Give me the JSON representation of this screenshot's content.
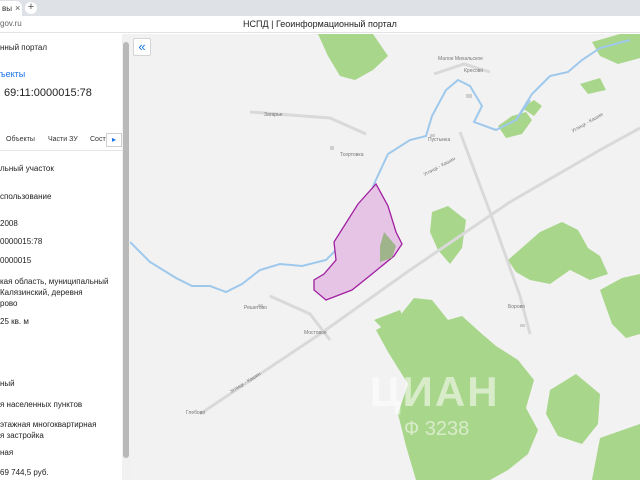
{
  "browser": {
    "tab_title": "вы",
    "tab_close": "×",
    "new_tab": "+",
    "address": "gov.ru",
    "page_title": "НСПД | Геоинформационный портал"
  },
  "panel": {
    "portal_label": "нный портал",
    "objects_link": "ъекты",
    "cadastral_number": "69:11:0000015:78",
    "tabs": [
      "Объекты",
      "Части ЗУ",
      "Сост"
    ],
    "tab_next": "▸",
    "object_type": "льный участок",
    "usage_label": "спользование",
    "date": "2008",
    "number_full": "0000015:78",
    "quarter": "0000015",
    "address_lines": [
      "кая область, муниципальный",
      "Калязинский, деревня",
      "рово"
    ],
    "area": "25 кв. м",
    "status": "ный",
    "category": "я населенных пунктов",
    "permitted_use_lines": [
      "этажная многоквартирная",
      "я застройка"
    ],
    "ownership": "ная",
    "cost": "69 744,5 руб."
  },
  "map": {
    "collapse_icon": "«",
    "watermark_main": "ЦИАН",
    "watermark_sub": "Ф 3238",
    "labels": {
      "top_village": "Малое Михальское",
      "kresovo": "Кресово",
      "zagarye": "Загарье",
      "tsvetkovo": "Тсертовка",
      "pustynka": "Пустынка",
      "reshetovo": "Решетово",
      "mostovoe": "Мостовое",
      "glebovo": "Глебово",
      "borovo": "Борово",
      "road1": "Углицк - Кашин",
      "road2": "Углицк - Кашин",
      "road3": "Углицк - Кашин"
    },
    "colors": {
      "background": "#f2f2f2",
      "forest": "#a8d68a",
      "river": "#9ec8ec",
      "parcel_fill": "#e6c4e6",
      "parcel_stroke": "#a020a0",
      "road": "#d9d9d9"
    }
  }
}
